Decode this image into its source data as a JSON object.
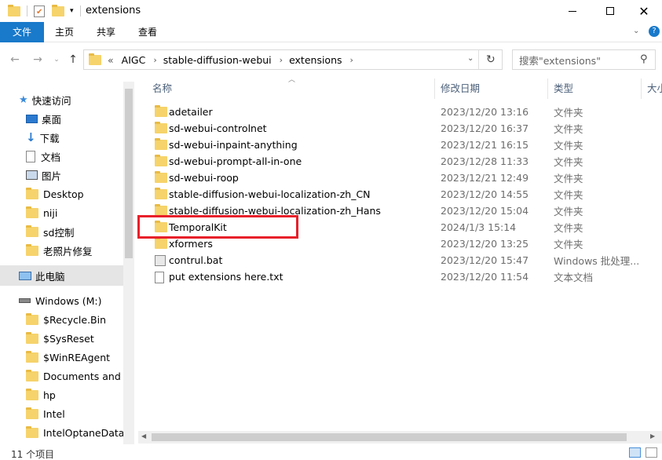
{
  "window": {
    "title": "extensions",
    "min_icon": "minimize-icon",
    "max_icon": "maximize-icon",
    "close_icon": "close-icon"
  },
  "ribbon": {
    "tabs": [
      "文件",
      "主页",
      "共享",
      "查看"
    ]
  },
  "address": {
    "prefix": "«",
    "crumbs": [
      "AIGC",
      "stable-diffusion-webui",
      "extensions"
    ]
  },
  "search": {
    "placeholder": "搜索\"extensions\""
  },
  "columns": {
    "name": "名称",
    "date": "修改日期",
    "type": "类型",
    "size": "大小"
  },
  "nav": {
    "quick_access": "快速访问",
    "pinned": [
      "桌面",
      "下载",
      "文档",
      "图片"
    ],
    "folders": [
      "Desktop",
      "niji",
      "sd控制",
      "老照片修复"
    ],
    "this_pc": "此电脑",
    "drive": "Windows (M:)",
    "drive_folders": [
      "$Recycle.Bin",
      "$SysReset",
      "$WinREAgent",
      "Documents and S",
      "hp",
      "Intel",
      "IntelOptaneData"
    ]
  },
  "files": [
    {
      "name": "adetailer",
      "date": "2023/12/20 13:16",
      "type": "文件夹",
      "icon": "folder-icon"
    },
    {
      "name": "sd-webui-controlnet",
      "date": "2023/12/20 16:37",
      "type": "文件夹",
      "icon": "folder-icon"
    },
    {
      "name": "sd-webui-inpaint-anything",
      "date": "2023/12/21 16:15",
      "type": "文件夹",
      "icon": "folder-icon"
    },
    {
      "name": "sd-webui-prompt-all-in-one",
      "date": "2023/12/28 11:33",
      "type": "文件夹",
      "icon": "folder-icon"
    },
    {
      "name": "sd-webui-roop",
      "date": "2023/12/21 12:49",
      "type": "文件夹",
      "icon": "folder-icon"
    },
    {
      "name": "stable-diffusion-webui-localization-zh_CN",
      "date": "2023/12/20 14:55",
      "type": "文件夹",
      "icon": "folder-icon"
    },
    {
      "name": "stable-diffusion-webui-localization-zh_Hans",
      "date": "2023/12/20 15:04",
      "type": "文件夹",
      "icon": "folder-icon"
    },
    {
      "name": "TemporalKit",
      "date": "2024/1/3 15:14",
      "type": "文件夹",
      "icon": "folder-icon"
    },
    {
      "name": "xformers",
      "date": "2023/12/20 13:25",
      "type": "文件夹",
      "icon": "folder-icon"
    },
    {
      "name": "contrul.bat",
      "date": "2023/12/20 15:47",
      "type": "Windows 批处理...",
      "icon": "bat-file-icon"
    },
    {
      "name": "put extensions here.txt",
      "date": "2023/12/20 11:54",
      "type": "文本文档",
      "icon": "text-file-icon"
    }
  ],
  "status": {
    "count": "11 个项目"
  }
}
